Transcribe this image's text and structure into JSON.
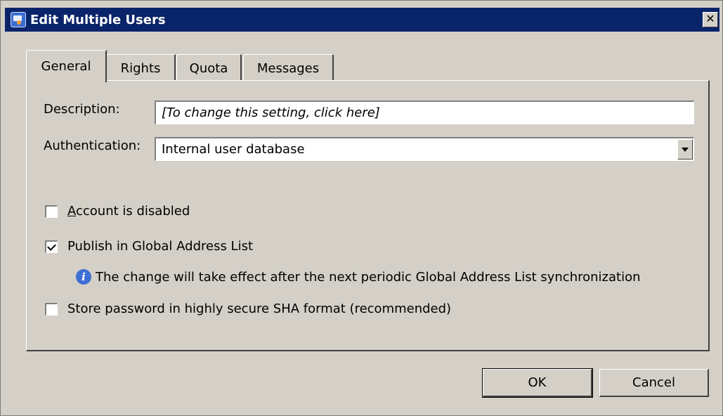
{
  "window": {
    "title": "Edit Multiple Users",
    "close_glyph": "✕"
  },
  "tabs": [
    {
      "label": "General",
      "active": true
    },
    {
      "label": "Rights",
      "active": false
    },
    {
      "label": "Quota",
      "active": false
    },
    {
      "label": "Messages",
      "active": false
    }
  ],
  "general": {
    "description_label": "Description:",
    "description_value": "[To change this setting, click here]",
    "authentication_label": "Authentication:",
    "authentication_value": "Internal user database",
    "account_disabled_mnemonic": "A",
    "account_disabled_rest": "ccount is disabled",
    "account_disabled_checked": false,
    "publish_gal_label": "Publish in Global Address List",
    "publish_gal_checked": true,
    "info_icon_glyph": "i",
    "info_text": "The change will take effect after the next periodic Global Address List synchronization",
    "store_sha_label": "Store password in highly secure SHA format (recommended)",
    "store_sha_checked": false
  },
  "buttons": {
    "ok": "OK",
    "cancel": "Cancel"
  },
  "icons": {
    "app": "app-icon",
    "close": "close-icon",
    "info": "info-icon",
    "dropdown": "chevron-down-icon",
    "check": "checkmark-icon"
  }
}
